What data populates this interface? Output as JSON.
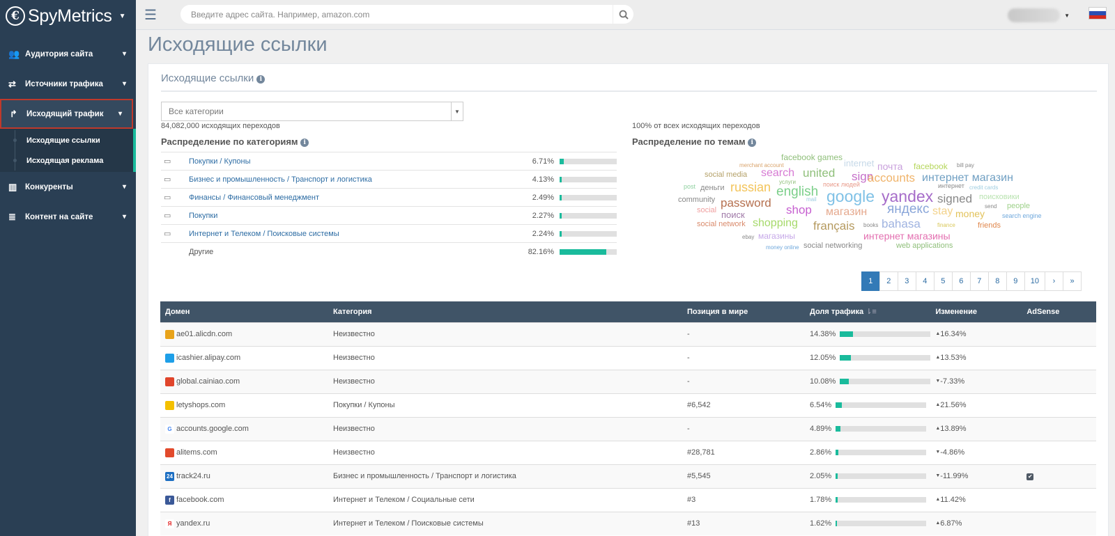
{
  "app": {
    "logo": "SpyMetrics"
  },
  "sidebar": {
    "items": [
      {
        "label": "Аудитория сайта"
      },
      {
        "label": "Источники трафика"
      },
      {
        "label": "Исходящий трафик"
      },
      {
        "label": "Конкуренты"
      },
      {
        "label": "Контент на сайте"
      }
    ],
    "sub_items": [
      {
        "label": "Исходящие ссылки"
      },
      {
        "label": "Исходящая реклама"
      }
    ]
  },
  "topbar": {
    "search_placeholder": "Введите адрес сайта. Например, amazon.com"
  },
  "page": {
    "title": "Исходящие ссылки",
    "panel_title": "Исходящие ссылки",
    "category_select": "Все категории",
    "outgoing_count": "84,082,000 исходящих переходов",
    "outgoing_share": "100% от всех исходящих переходов",
    "cat_section_title": "Распределение по категориям",
    "topic_section_title": "Распределение по темам"
  },
  "categories": [
    {
      "label": "Покупки / Купоны",
      "pct": "6.71%",
      "value": 6.71
    },
    {
      "label": "Бизнес и промышленность / Транспорт и логистика",
      "pct": "4.13%",
      "value": 4.13
    },
    {
      "label": "Финансы / Финансовый менеджмент",
      "pct": "2.49%",
      "value": 2.49
    },
    {
      "label": "Покупки",
      "pct": "2.27%",
      "value": 2.27
    },
    {
      "label": "Интернет и Телеком / Поисковые системы",
      "pct": "2.24%",
      "value": 2.24
    },
    {
      "label": "Другие",
      "pct": "82.16%",
      "value": 82.16
    }
  ],
  "word_cloud": [
    {
      "w": "facebook games",
      "c": "#8fbf7a"
    },
    {
      "w": "internet",
      "c": "#c6d9e8"
    },
    {
      "w": "почта",
      "c": "#c9a0dc"
    },
    {
      "w": "facebook",
      "c": "#b5d65a"
    },
    {
      "w": "bill pay",
      "c": "#888"
    },
    {
      "w": "merchant account",
      "c": "#d9a36b"
    },
    {
      "w": "social media",
      "c": "#b5a26a"
    },
    {
      "w": "search",
      "c": "#d77bd4"
    },
    {
      "w": "united",
      "c": "#8fbf7a"
    },
    {
      "w": "sign",
      "c": "#c56fc9"
    },
    {
      "w": "accounts",
      "c": "#f0b46b"
    },
    {
      "w": "интернет магазин",
      "c": "#6f9fc2"
    },
    {
      "w": "post",
      "c": "#8fd1a0"
    },
    {
      "w": "деньги",
      "c": "#888"
    },
    {
      "w": "russian",
      "c": "#f3c45a"
    },
    {
      "w": "услуги",
      "c": "#8fbf7a"
    },
    {
      "w": "english",
      "c": "#7ccf8a"
    },
    {
      "w": "поиск людей",
      "c": "#e89a8a"
    },
    {
      "w": "интернет",
      "c": "#888"
    },
    {
      "w": "credit cards",
      "c": "#9ecde0"
    },
    {
      "w": "community",
      "c": "#888"
    },
    {
      "w": "password",
      "c": "#b5704f"
    },
    {
      "w": "mail",
      "c": "#9ecde0"
    },
    {
      "w": "google",
      "c": "#7fc1e6"
    },
    {
      "w": "yandex",
      "c": "#a66cc9"
    },
    {
      "w": "signed",
      "c": "#888"
    },
    {
      "w": "поисковики",
      "c": "#b9e3b0"
    },
    {
      "w": "social",
      "c": "#f0a0a0"
    },
    {
      "w": "shop",
      "c": "#c65fd0"
    },
    {
      "w": "магазин",
      "c": "#e5a98e"
    },
    {
      "w": "яндекс",
      "c": "#8aa6d9"
    },
    {
      "w": "stay",
      "c": "#f3d28a"
    },
    {
      "w": "send",
      "c": "#888"
    },
    {
      "w": "people",
      "c": "#9ed18a"
    },
    {
      "w": "поиск",
      "c": "#a07aa8"
    },
    {
      "w": "money",
      "c": "#e2c25a"
    },
    {
      "w": "search engine",
      "c": "#6fa8dc"
    },
    {
      "w": "social network",
      "c": "#d98a6b"
    },
    {
      "w": "shopping",
      "c": "#a6d96a"
    },
    {
      "w": "français",
      "c": "#b59a5f"
    },
    {
      "w": "books",
      "c": "#888"
    },
    {
      "w": "bahasa",
      "c": "#9fb3e0"
    },
    {
      "w": "finance",
      "c": "#d9c85a"
    },
    {
      "w": "friends",
      "c": "#e0874d"
    },
    {
      "w": "ebay",
      "c": "#888"
    },
    {
      "w": "магазины",
      "c": "#c6a8e8"
    },
    {
      "w": "интернет магазины",
      "c": "#e36fb0"
    },
    {
      "w": "money online",
      "c": "#6fa8dc"
    },
    {
      "w": "social networking",
      "c": "#888"
    },
    {
      "w": "web applications",
      "c": "#8fbf7a"
    }
  ],
  "pagination": [
    "1",
    "2",
    "3",
    "4",
    "5",
    "6",
    "7",
    "8",
    "9",
    "10",
    "›",
    "»"
  ],
  "table": {
    "headers": [
      "Домен",
      "Категория",
      "Позиция в мире",
      "Доля трафика",
      "Изменение",
      "AdSense"
    ],
    "rows": [
      {
        "domain": "ae01.alicdn.com",
        "category": "Неизвестно",
        "rank": "-",
        "share": "14.38%",
        "share_val": 14.38,
        "change": "16.34%",
        "dir": "up",
        "adsense": false,
        "fav": "#e8a31a",
        "fav_t": ""
      },
      {
        "domain": "icashier.alipay.com",
        "category": "Неизвестно",
        "rank": "-",
        "share": "12.05%",
        "share_val": 12.05,
        "change": "13.53%",
        "dir": "up",
        "adsense": false,
        "fav": "#1e9fe8",
        "fav_t": ""
      },
      {
        "domain": "global.cainiao.com",
        "category": "Неизвестно",
        "rank": "-",
        "share": "10.08%",
        "share_val": 10.08,
        "change": "-7.33%",
        "dir": "down",
        "adsense": false,
        "fav": "#e0452b",
        "fav_t": ""
      },
      {
        "domain": "letyshops.com",
        "category": "Покупки / Купоны",
        "rank": "#6,542",
        "share": "6.54%",
        "share_val": 6.54,
        "change": "21.56%",
        "dir": "up",
        "adsense": false,
        "fav": "#f4c000",
        "fav_t": ""
      },
      {
        "domain": "accounts.google.com",
        "category": "Неизвестно",
        "rank": "-",
        "share": "4.89%",
        "share_val": 4.89,
        "change": "13.89%",
        "dir": "up",
        "adsense": false,
        "fav": "#ffffff",
        "fav_t": "G"
      },
      {
        "domain": "alitems.com",
        "category": "Неизвестно",
        "rank": "#28,781",
        "share": "2.86%",
        "share_val": 2.86,
        "change": "-4.86%",
        "dir": "down",
        "adsense": false,
        "fav": "#e24a2c",
        "fav_t": ""
      },
      {
        "domain": "track24.ru",
        "category": "Бизнес и промышленность / Транспорт и логистика",
        "rank": "#5,545",
        "share": "2.05%",
        "share_val": 2.05,
        "change": "-11.99%",
        "dir": "down",
        "adsense": true,
        "fav": "#1c6ec2",
        "fav_t": "24"
      },
      {
        "domain": "facebook.com",
        "category": "Интернет и Телеком / Социальные сети",
        "rank": "#3",
        "share": "1.78%",
        "share_val": 1.78,
        "change": "11.42%",
        "dir": "up",
        "adsense": false,
        "fav": "#3b5998",
        "fav_t": "f"
      },
      {
        "domain": "yandex.ru",
        "category": "Интернет и Телеком / Поисковые системы",
        "rank": "#13",
        "share": "1.62%",
        "share_val": 1.62,
        "change": "6.87%",
        "dir": "up",
        "adsense": false,
        "fav": "#ffffff",
        "fav_t": "Я"
      }
    ]
  }
}
